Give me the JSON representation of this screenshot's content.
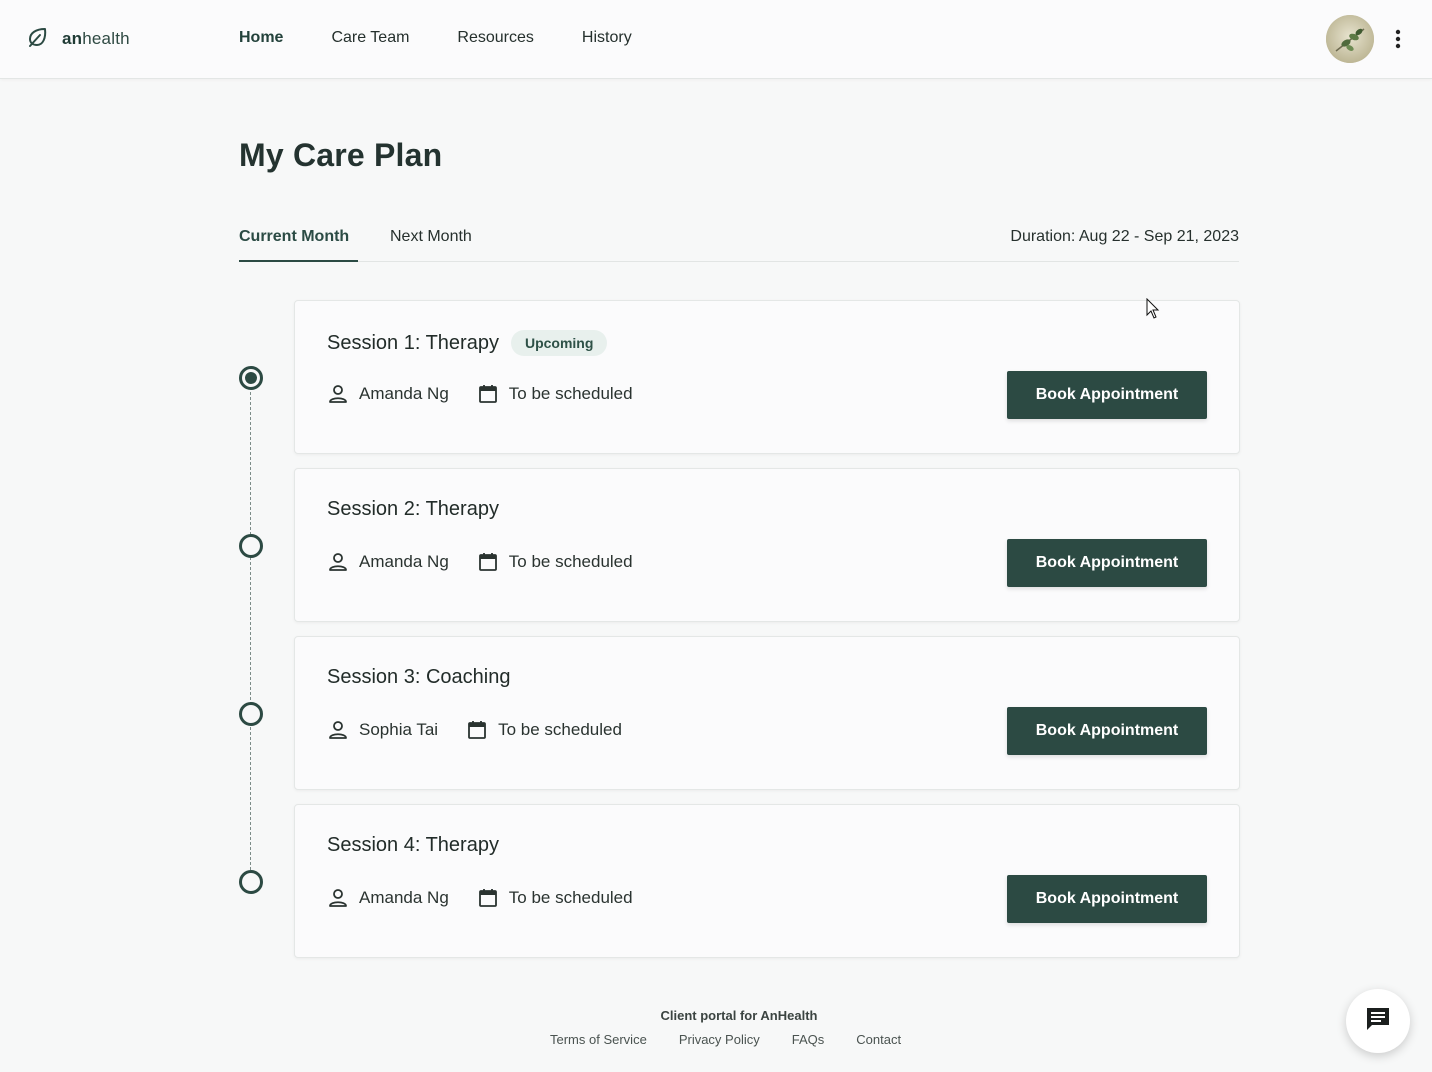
{
  "header": {
    "brand_bold": "an",
    "brand_rest": "health",
    "nav": [
      {
        "label": "Home",
        "active": true
      },
      {
        "label": "Care Team",
        "active": false
      },
      {
        "label": "Resources",
        "active": false
      },
      {
        "label": "History",
        "active": false
      }
    ],
    "icons": {
      "logo": "leaf-logo-icon",
      "menu": "kebab-menu-icon"
    }
  },
  "page": {
    "title": "My Care Plan",
    "tabs": [
      {
        "label": "Current Month",
        "selected": true
      },
      {
        "label": "Next Month",
        "selected": false
      }
    ],
    "duration": "Duration: Aug 22 - Sep 21, 2023"
  },
  "sessions": [
    {
      "title": "Session 1: Therapy",
      "badge": "Upcoming",
      "provider": "Amanda Ng",
      "schedule": "To be scheduled",
      "button": "Book Appointment",
      "current": true
    },
    {
      "title": "Session 2: Therapy",
      "badge": "",
      "provider": "Amanda Ng",
      "schedule": "To be scheduled",
      "button": "Book Appointment",
      "current": false
    },
    {
      "title": "Session 3: Coaching",
      "badge": "",
      "provider": "Sophia Tai",
      "schedule": "To be scheduled",
      "button": "Book Appointment",
      "current": false
    },
    {
      "title": "Session 4: Therapy",
      "badge": "",
      "provider": "Amanda Ng",
      "schedule": "To be scheduled",
      "button": "Book Appointment",
      "current": false
    }
  ],
  "footer": {
    "title": "Client portal for AnHealth",
    "links": [
      "Terms of Service",
      "Privacy Policy",
      "FAQs",
      "Contact"
    ]
  },
  "colors": {
    "primary": "#2c4a43",
    "badge_bg": "#e8f0ed",
    "background": "#f7f8f8"
  }
}
